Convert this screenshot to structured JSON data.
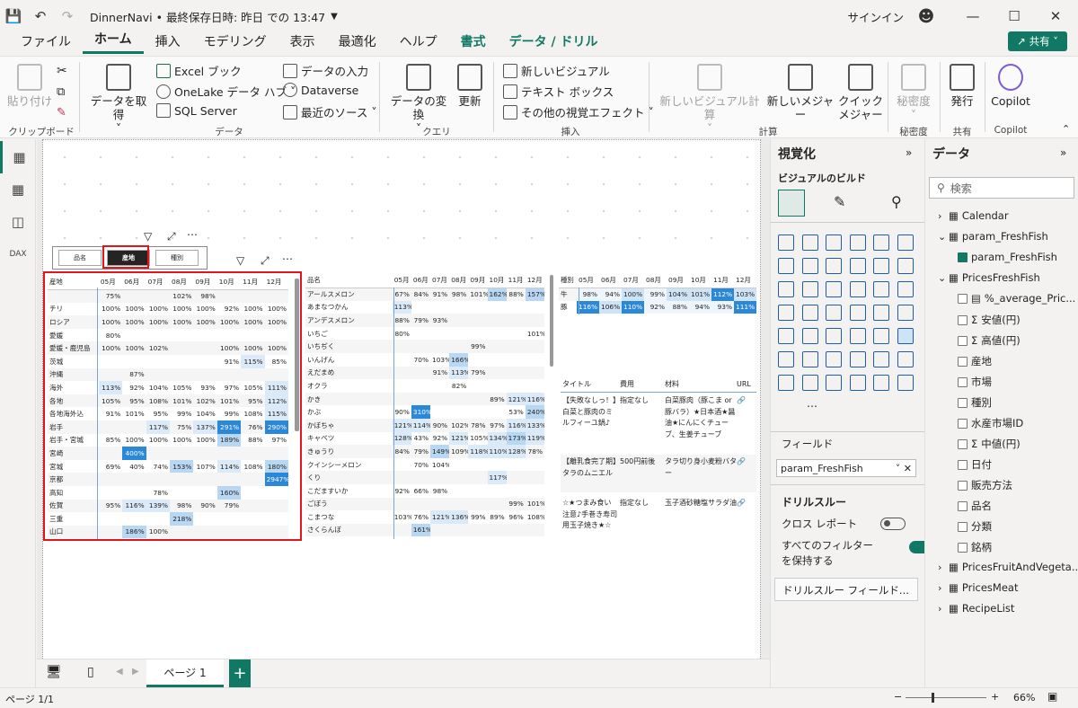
{
  "app": {
    "title": "DinnerNavi • 最終保存日時: 昨日 での 13:47",
    "signin": "サインイン",
    "share": "共有"
  },
  "menu": {
    "tabs": [
      "ファイル",
      "ホーム",
      "挿入",
      "モデリング",
      "表示",
      "最適化",
      "ヘルプ",
      "書式",
      "データ / ドリル"
    ],
    "active": "ホーム"
  },
  "ribbon": {
    "paste": "貼り付け",
    "clipboard": "クリップボード",
    "get_data": "データを取得",
    "excel": "Excel ブック",
    "onelake": "OneLake データ ハブ",
    "sql": "SQL Server",
    "enter_data": "データの入力",
    "dataverse": "Dataverse",
    "recent": "最近のソース",
    "data_group": "データ",
    "transform": "データの変換",
    "refresh": "更新",
    "query_group": "クエリ",
    "new_visual": "新しいビジュアル",
    "textbox": "テキスト ボックス",
    "more_visuals": "その他の視覚エフェクト",
    "insert_group": "挿入",
    "new_visual_calc": "新しいビジュアル計算",
    "new_measure": "新しいメジャー",
    "quick_measure": "クイック メジャー",
    "calc_group": "計算",
    "sensitivity": "秘密度",
    "sensitivity_group": "秘密度",
    "publish": "発行",
    "share_group": "共有",
    "copilot": "Copilot",
    "copilot_group": "Copilot"
  },
  "slicer": {
    "chips": [
      "品名",
      "産地",
      "種別"
    ],
    "selected": "産地"
  },
  "matrix_left": {
    "row_header": "産地",
    "months": [
      "05月",
      "06月",
      "07月",
      "08月",
      "09月",
      "10月",
      "11月",
      "12月"
    ],
    "rows": [
      [
        "",
        "75%",
        "",
        "",
        "102%",
        "98%",
        "",
        "",
        ""
      ],
      [
        "チリ",
        "100%",
        "100%",
        "100%",
        "100%",
        "100%",
        "92%",
        "100%",
        "100%"
      ],
      [
        "ロシア",
        "100%",
        "100%",
        "100%",
        "100%",
        "100%",
        "100%",
        "100%",
        "100%"
      ],
      [
        "愛媛",
        "80%",
        "",
        "",
        "",
        "",
        "",
        "",
        ""
      ],
      [
        "愛媛・鹿児島",
        "100%",
        "100%",
        "102%",
        "",
        "",
        "100%",
        "100%",
        "100%"
      ],
      [
        "茨城",
        "",
        "",
        "",
        "",
        "",
        "91%",
        "115%",
        "85%"
      ],
      [
        "沖縄",
        "",
        "87%",
        "",
        "",
        "",
        "",
        "",
        ""
      ],
      [
        "海外",
        "113%",
        "92%",
        "104%",
        "105%",
        "93%",
        "97%",
        "105%",
        "111%"
      ],
      [
        "各地",
        "105%",
        "95%",
        "108%",
        "101%",
        "102%",
        "101%",
        "95%",
        "112%"
      ],
      [
        "各地海外込",
        "91%",
        "101%",
        "95%",
        "99%",
        "104%",
        "99%",
        "108%",
        "115%"
      ],
      [
        "岩手",
        "",
        "",
        "117%",
        "75%",
        "137%",
        "291%",
        "76%",
        "290%"
      ],
      [
        "岩手・宮城",
        "85%",
        "100%",
        "100%",
        "100%",
        "100%",
        "189%",
        "88%",
        "97%"
      ],
      [
        "宮崎",
        "",
        "400%",
        "",
        "",
        "",
        "",
        "",
        ""
      ],
      [
        "宮城",
        "69%",
        "40%",
        "74%",
        "153%",
        "107%",
        "114%",
        "108%",
        "180%"
      ],
      [
        "京都",
        "",
        "",
        "",
        "",
        "",
        "",
        "",
        "2947%"
      ],
      [
        "高知",
        "",
        "",
        "78%",
        "",
        "",
        "160%",
        "",
        ""
      ],
      [
        "佐賀",
        "95%",
        "116%",
        "139%",
        "98%",
        "90%",
        "79%",
        "",
        ""
      ],
      [
        "三重",
        "",
        "",
        "",
        "218%",
        "",
        "",
        "",
        ""
      ],
      [
        "山口",
        "",
        "186%",
        "100%",
        "",
        "",
        "",
        "",
        ""
      ]
    ]
  },
  "matrix_mid": {
    "row_header": "品名",
    "months": [
      "05月",
      "06月",
      "07月",
      "08月",
      "09月",
      "10月",
      "11月",
      "12月"
    ],
    "rows": [
      [
        "アールスメロン",
        "67%",
        "84%",
        "91%",
        "98%",
        "101%",
        "162%",
        "88%",
        "157%"
      ],
      [
        "あまなつかん",
        "113%",
        "",
        "",
        "",
        "",
        "",
        "",
        ""
      ],
      [
        "アンデスメロン",
        "88%",
        "79%",
        "93%",
        "",
        "",
        "",
        "",
        ""
      ],
      [
        "いちご",
        "80%",
        "",
        "",
        "",
        "",
        "",
        "",
        "101%"
      ],
      [
        "いちぢく",
        "",
        "",
        "",
        "",
        "99%",
        "",
        "",
        ""
      ],
      [
        "いんげん",
        "",
        "70%",
        "103%",
        "166%",
        "",
        "",
        "",
        ""
      ],
      [
        "えだまめ",
        "",
        "",
        "91%",
        "113%",
        "79%",
        "",
        "",
        ""
      ],
      [
        "オクラ",
        "",
        "",
        "",
        "82%",
        "",
        "",
        "",
        ""
      ],
      [
        "かき",
        "",
        "",
        "",
        "",
        "",
        "89%",
        "121%",
        "116%"
      ],
      [
        "かぶ",
        "90%",
        "310%",
        "",
        "",
        "",
        "",
        "53%",
        "240%"
      ],
      [
        "かぼちゃ",
        "121%",
        "114%",
        "90%",
        "102%",
        "78%",
        "97%",
        "116%",
        "133%"
      ],
      [
        "キャベツ",
        "128%",
        "43%",
        "92%",
        "121%",
        "105%",
        "134%",
        "173%",
        "119%"
      ],
      [
        "きゅうり",
        "84%",
        "79%",
        "149%",
        "109%",
        "118%",
        "110%",
        "128%",
        "78%"
      ],
      [
        "クインシーメロン",
        "",
        "70%",
        "104%",
        "",
        "",
        "",
        "",
        ""
      ],
      [
        "くり",
        "",
        "",
        "",
        "",
        "",
        "117%",
        "",
        ""
      ],
      [
        "こだますいか",
        "92%",
        "66%",
        "98%",
        "",
        "",
        "",
        "",
        ""
      ],
      [
        "ごぼう",
        "",
        "",
        "",
        "",
        "",
        "",
        "99%",
        "101%"
      ],
      [
        "こまつな",
        "103%",
        "76%",
        "121%",
        "136%",
        "99%",
        "89%",
        "96%",
        "108%"
      ],
      [
        "さくらんぼ",
        "",
        "161%",
        "",
        "",
        "",
        "",
        "",
        ""
      ]
    ]
  },
  "matrix_right": {
    "row_header": "種別",
    "months": [
      "05月",
      "06月",
      "07月",
      "08月",
      "09月",
      "10月",
      "11月",
      "12月"
    ],
    "rows": [
      [
        "牛",
        "98%",
        "94%",
        "100%",
        "99%",
        "104%",
        "101%",
        "112%",
        "103%"
      ],
      [
        "豚",
        "116%",
        "106%",
        "110%",
        "92%",
        "88%",
        "94%",
        "93%",
        "111%"
      ]
    ]
  },
  "recipes": {
    "headers": [
      "タイトル",
      "費用",
      "材料",
      "URL"
    ],
    "rows": [
      {
        "title": "【失敗なしっ！】白菜と豚肉のミルフィーユ鍋♪",
        "cost": "指定なし",
        "ingredients": "白菜豚肉（豚こま or豚バラ）★日本酒★醤油★にんにくチューブ、生姜チューブ"
      },
      {
        "title": "【離乳食完了期】タラのムニエル",
        "cost": "500円前後",
        "ingredients": "タラ切り身小麦粉バター"
      },
      {
        "title": "☆★つまみ食い注意♪手巻き寿司用玉子焼き★☆",
        "cost": "指定なし",
        "ingredients": "玉子酒砂糖塩サラダ油"
      }
    ]
  },
  "viz_panel": {
    "title": "視覚化",
    "subtitle": "ビジュアルのビルド",
    "field_label": "フィールド",
    "field_value": "param_FreshFish",
    "drill_title": "ドリルスルー",
    "cross_report": "クロス レポート",
    "keep_filters": "すべてのフィルターを保持する",
    "drill_field": "ドリルスルー フィールド..."
  },
  "data_panel": {
    "title": "データ",
    "search_placeholder": "検索",
    "items": [
      {
        "label": "Calendar",
        "level": 0,
        "type": "table"
      },
      {
        "label": "param_FreshFish",
        "level": 0,
        "type": "param"
      },
      {
        "label": "param_FreshFish",
        "level": 1,
        "type": "field",
        "checked": true
      },
      {
        "label": "PricesFreshFish",
        "level": 0,
        "type": "table"
      },
      {
        "label": "%_average_Pric...",
        "level": 1,
        "type": "measure"
      },
      {
        "label": "安値(円)",
        "level": 1,
        "type": "sum"
      },
      {
        "label": "高値(円)",
        "level": 1,
        "type": "sum"
      },
      {
        "label": "産地",
        "level": 1,
        "type": "field"
      },
      {
        "label": "市場",
        "level": 1,
        "type": "field"
      },
      {
        "label": "種別",
        "level": 1,
        "type": "field"
      },
      {
        "label": "水産市場ID",
        "level": 1,
        "type": "field"
      },
      {
        "label": "中値(円)",
        "level": 1,
        "type": "sum"
      },
      {
        "label": "日付",
        "level": 1,
        "type": "field"
      },
      {
        "label": "販売方法",
        "level": 1,
        "type": "field"
      },
      {
        "label": "品名",
        "level": 1,
        "type": "field"
      },
      {
        "label": "分類",
        "level": 1,
        "type": "field"
      },
      {
        "label": "銘柄",
        "level": 1,
        "type": "field"
      },
      {
        "label": "PricesFruitAndVegeta...",
        "level": 0,
        "type": "table"
      },
      {
        "label": "PricesMeat",
        "level": 0,
        "type": "table"
      },
      {
        "label": "RecipeList",
        "level": 0,
        "type": "table"
      }
    ]
  },
  "pages": {
    "tab": "ページ 1",
    "status": "ページ 1/1",
    "zoom": "66%"
  },
  "colors": {
    "accent": "#117865",
    "highlight": "#e3141b",
    "cell_blue": "#2b88d8"
  }
}
